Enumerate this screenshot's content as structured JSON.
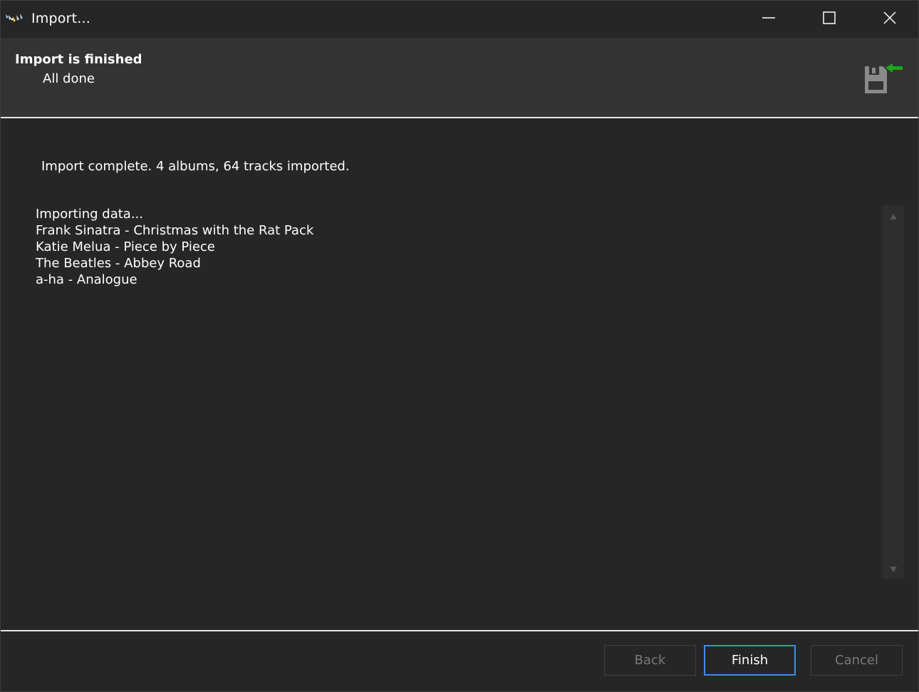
{
  "window": {
    "title": "Import..."
  },
  "header": {
    "title": "Import is finished",
    "subtitle": "All done",
    "icon": "import-disk-icon"
  },
  "main": {
    "status": "Import complete. 4 albums, 64 tracks imported.",
    "log": [
      "Importing data...",
      "Frank Sinatra - Christmas with the Rat Pack",
      "Katie Melua - Piece by Piece",
      "The Beatles - Abbey Road",
      "a-ha - Analogue"
    ]
  },
  "footer": {
    "back_label": "Back",
    "finish_label": "Finish",
    "cancel_label": "Cancel"
  },
  "colors": {
    "background": "#262626",
    "header_background": "#333333",
    "accent": "#3d8ee6",
    "arrow_green": "#1aa61a",
    "disabled_text": "#7a7a7a"
  }
}
